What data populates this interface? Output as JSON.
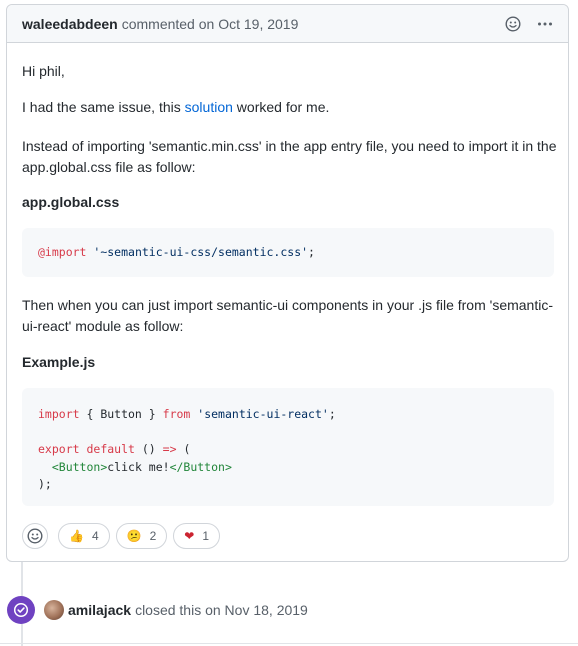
{
  "comment": {
    "author": "waleedabdeen",
    "meta": "commented on Oct 19, 2019",
    "greeting": "Hi phil,",
    "p2_before": "I had the same issue, this ",
    "p2_link": "solution",
    "p2_after": " worked for me.",
    "p3": "Instead of importing 'semantic.min.css' in the app entry file, you need to import it in the app.global.css file as follow:",
    "heading1": "app.global.css",
    "code1": {
      "kw": "@import",
      "space": " ",
      "str": "'~semantic-ui-css/semantic.css'",
      "end": ";"
    },
    "p4": "Then when you can just import semantic-ui components in your .js file from 'semantic-ui-react' module as follow:",
    "heading2": "Example.js",
    "code2": {
      "l1_kw1": "import",
      "l1_mid": " { Button } ",
      "l1_kw2": "from",
      "l1_sp": " ",
      "l1_str": "'semantic-ui-react'",
      "l1_end": ";",
      "l3_kw1": "export",
      "l3_sp": " ",
      "l3_kw2": "default",
      "l3_mid": " () ",
      "l3_arrow": "=>",
      "l3_end": " (",
      "l4_indent": "  ",
      "l4_tag1": "<Button>",
      "l4_text": "click me!",
      "l4_tag2": "</Button>",
      "l5": ");"
    },
    "reactions": [
      {
        "emoji": "👍",
        "count": "4"
      },
      {
        "emoji": "😕",
        "count": "2"
      },
      {
        "emoji": "❤",
        "count": "1"
      }
    ]
  },
  "event": {
    "actor": "amilajack",
    "text": "closed this on Nov 18, 2019"
  },
  "colors": {
    "link": "#0366d6",
    "closed_badge": "#6f42c1",
    "keyword": "#d73a49",
    "string": "#032f62"
  },
  "icons": {
    "emoji_picker": "smiley-icon",
    "more": "kebab-horizontal-icon",
    "closed": "issue-closed-icon"
  }
}
